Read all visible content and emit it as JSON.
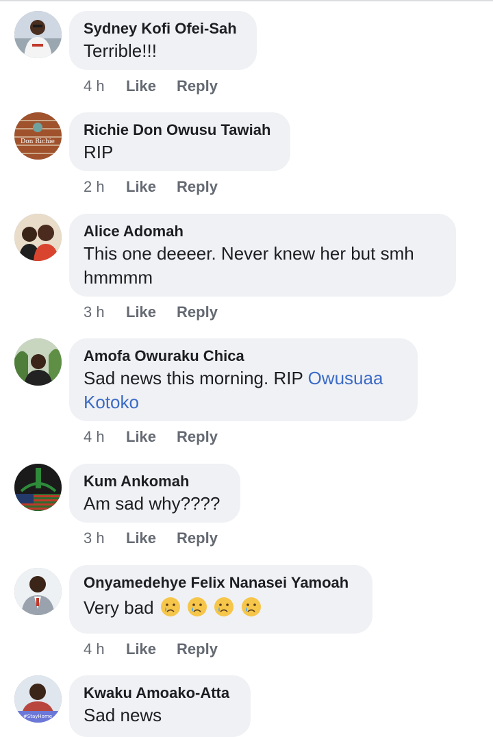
{
  "comments": [
    {
      "author": "Sydney Kofi Ofei-Sah",
      "text": "Terrible!!!",
      "time": "4 h",
      "like": "Like",
      "reply": "Reply"
    },
    {
      "author": "Richie Don Owusu Tawiah",
      "text": "RIP",
      "time": "2 h",
      "like": "Like",
      "reply": "Reply",
      "avatar_text": "Don Richie"
    },
    {
      "author": "Alice Adomah",
      "text": "This one deeeer. Never knew her but smh hmmmm",
      "time": "3 h",
      "like": "Like",
      "reply": "Reply"
    },
    {
      "author": "Amofa Owuraku Chica",
      "text": "Sad news this morning. RIP ",
      "mention": "Owusuaa Kotoko",
      "time": "4 h",
      "like": "Like",
      "reply": "Reply"
    },
    {
      "author": "Kum Ankomah",
      "text": "Am sad why????",
      "time": "3 h",
      "like": "Like",
      "reply": "Reply"
    },
    {
      "author": "Onyamedehye Felix Nanasei Yamoah",
      "text": "Very bad",
      "emojis": [
        "crying-face",
        "crying-face",
        "crying-face",
        "crying-face"
      ],
      "time": "4 h",
      "like": "Like",
      "reply": "Reply"
    },
    {
      "author": "Kwaku Amoako-Atta",
      "text": "Sad news",
      "time": "",
      "like": "",
      "reply": "",
      "avatar_text": "#StayHome"
    }
  ],
  "colors": {
    "bubble": "#f0f1f4",
    "name": "#1c1e21",
    "meta": "#656a73",
    "mention": "#3b6bc7"
  }
}
